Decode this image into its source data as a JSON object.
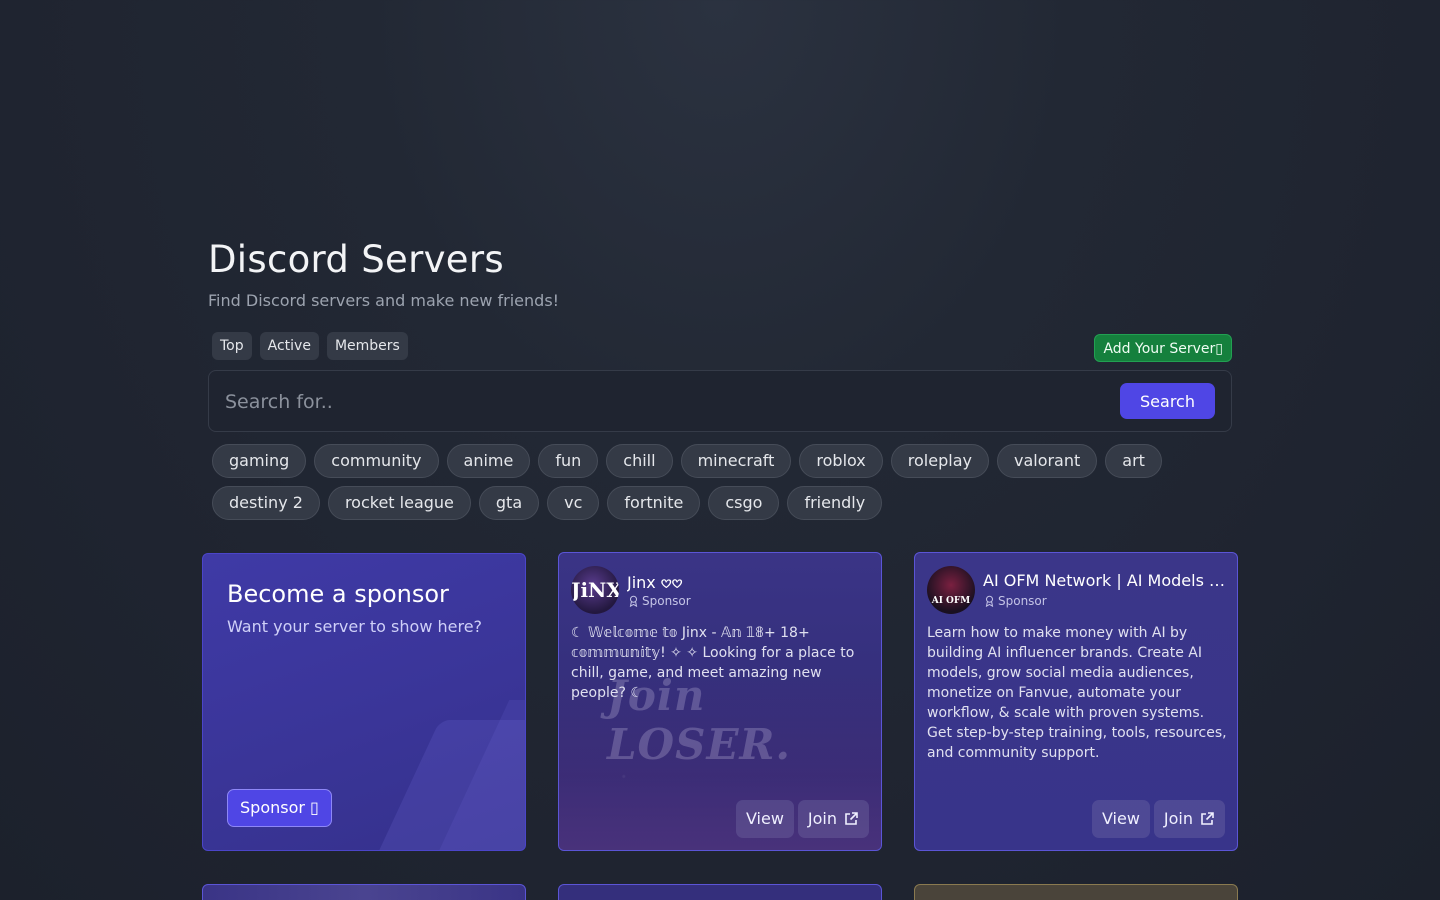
{
  "header": {
    "title": "Discord Servers",
    "subtitle": "Find Discord servers and make new friends!"
  },
  "sort_tabs": [
    "Top",
    "Active",
    "Members"
  ],
  "add_server_label": "Add Your Server",
  "add_server_icon": "plus-icon",
  "search": {
    "placeholder": "Search for..",
    "button_label": "Search"
  },
  "tags": [
    "gaming",
    "community",
    "anime",
    "fun",
    "chill",
    "minecraft",
    "roblox",
    "roleplay",
    "valorant",
    "art",
    "destiny 2",
    "rocket league",
    "gta",
    "vc",
    "fortnite",
    "csgo",
    "friendly"
  ],
  "sponsor_card": {
    "title": "Become a sponsor",
    "subtitle": "Want your server to show here?",
    "button_label": "Sponsor",
    "button_icon": "external-link-icon"
  },
  "servers": [
    {
      "name": "Jinx 𖹭𖹭",
      "badge": "Sponsor",
      "avatar_text": "JiNX",
      "banner_text": "Join LOSER.",
      "description": "☾ 𝕎𝕖𝕝𝕔𝕠𝕞𝕖 𝕥𝕠 Jinx - 𝔸𝕟 𝟙𝟠+ 18+ 𝕔𝕠𝕞𝕞𝕦𝕟𝕚𝕥𝕪! ✧ ✧ Looking for a place to chill, game, and meet amazing new people? ☾",
      "view_label": "View",
      "join_label": "Join"
    },
    {
      "name": "AI OFM Network | AI Models & Agency",
      "badge": "Sponsor",
      "avatar_text": "AI OFM",
      "description": "Learn how to make money with AI by building AI influencer brands. Create AI models, grow social media audiences, monetize on Fanvue, automate your workflow, & scale with proven systems. Get step-by-step training, tools, resources, and community support.",
      "view_label": "View",
      "join_label": "Join"
    }
  ],
  "colors": {
    "accent": "#4f46e5",
    "add_server": "#15803d",
    "card": "#3a3486"
  }
}
